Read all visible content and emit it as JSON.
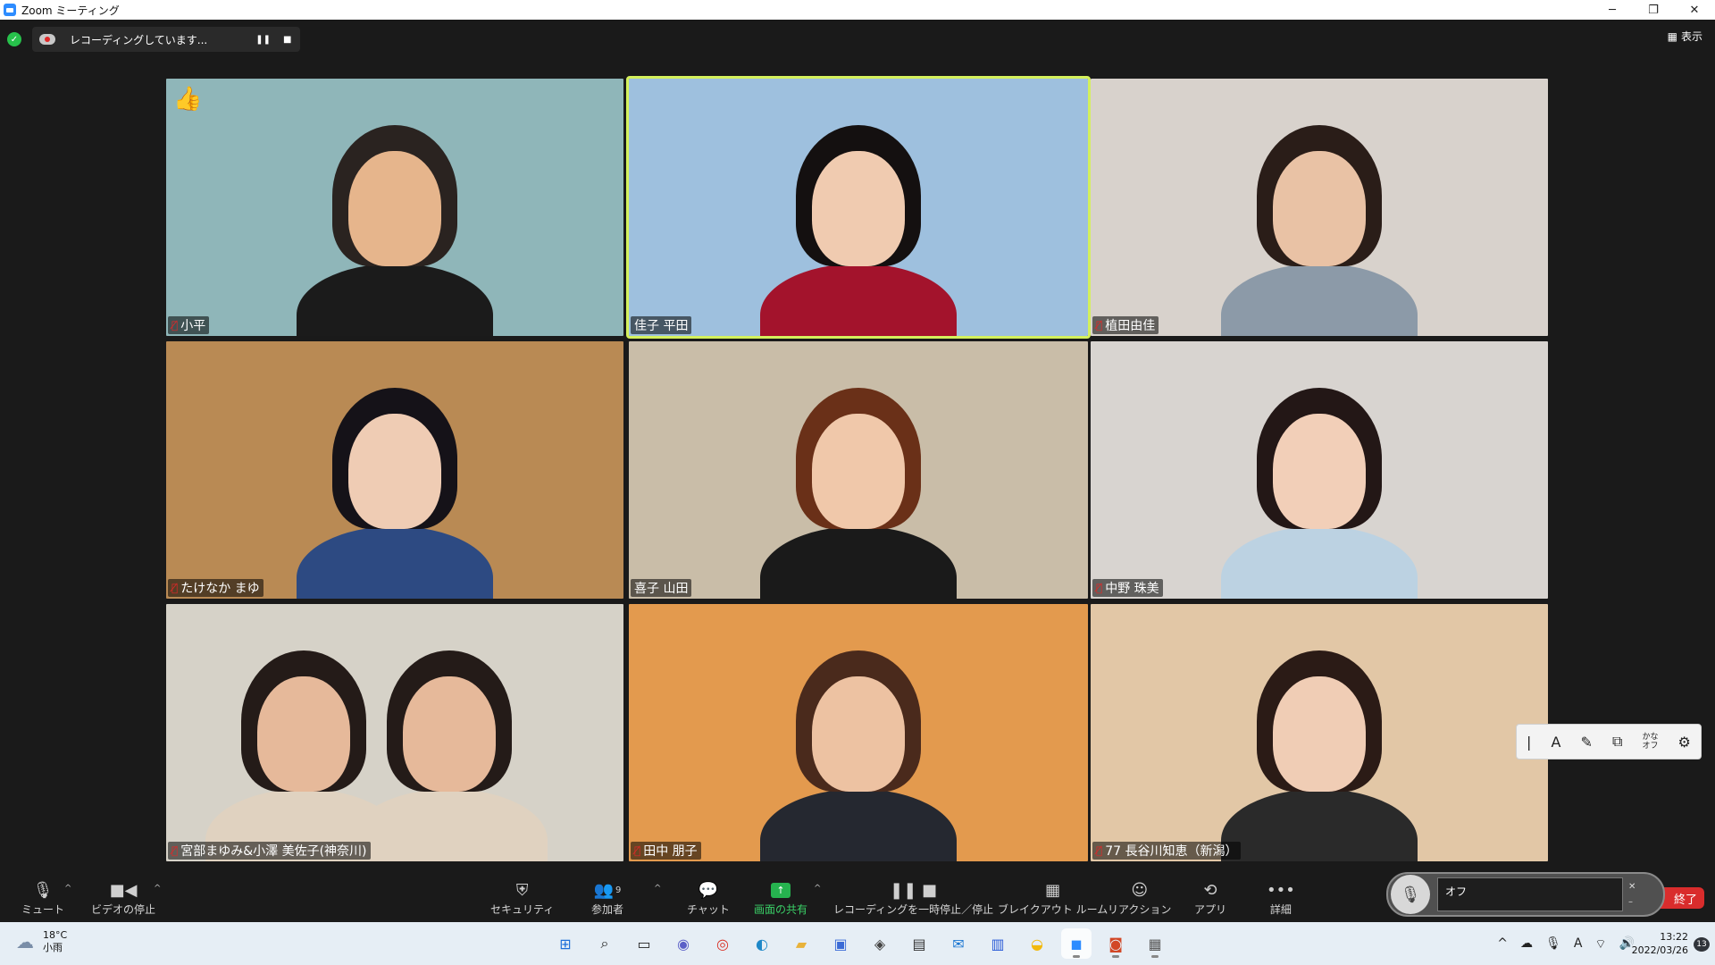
{
  "window": {
    "title": "Zoom ミーティング",
    "controls": [
      "─",
      "❐",
      "✕"
    ]
  },
  "recording": {
    "status": "レコーディングしています...",
    "pause": "❚❚",
    "stop": "■"
  },
  "view": {
    "label": "表示",
    "icon": "grid-icon"
  },
  "participants": [
    {
      "name": "小平",
      "muted": true,
      "bg": "#8fb6b9",
      "skin": "#e6b58c",
      "hair": "#2a2320",
      "shirt": "#1b1b1b",
      "reaction": "👍"
    },
    {
      "name": "佳子 平田",
      "muted": false,
      "bg": "#9ec0de",
      "skin": "#f0cbb0",
      "hair": "#141010",
      "shirt": "#a3132c",
      "active": true
    },
    {
      "name": "植田由佳",
      "muted": true,
      "bg": "#d8d2cc",
      "skin": "#e9c2a5",
      "hair": "#2a1d18",
      "shirt": "#8c9aa8"
    },
    {
      "name": "たけなか まゆ",
      "muted": true,
      "bg": "#b98a54",
      "skin": "#efccb4",
      "hair": "#151218",
      "shirt": "#2d4a82"
    },
    {
      "name": "喜子 山田",
      "muted": false,
      "bg": "#c9bda8",
      "skin": "#f0c8aa",
      "hair": "#6a3018",
      "shirt": "#1a1a1a"
    },
    {
      "name": "中野 珠美",
      "muted": true,
      "bg": "#d8d4d0",
      "skin": "#f2cfb8",
      "hair": "#231716",
      "shirt": "#bcd2e2"
    },
    {
      "name": "宮部まゆみ&小澤 美佐子(神奈川)",
      "muted": true,
      "bg": "#d6d2c8",
      "skin": "#e6b99a",
      "hair": "#241b18",
      "shirt": "#e0d2c0"
    },
    {
      "name": "田中 朋子",
      "muted": true,
      "bg": "#e39a4e",
      "skin": "#edc2a2",
      "hair": "#4a2a1c",
      "shirt": "#252830"
    },
    {
      "name": "77  長谷川知恵（新潟）",
      "muted": true,
      "bg": "#e2c7a6",
      "skin": "#f0cdb5",
      "hair": "#2b1b16",
      "shirt": "#2a2a2a"
    }
  ],
  "palette": {
    "items": [
      "|",
      "A",
      "✎",
      "⧉",
      "かな\nオフ",
      "⚙"
    ],
    "icons": [
      "cursor-icon",
      "font-icon",
      "pen-icon",
      "dictionary-icon",
      "kana-off",
      "settings-icon"
    ]
  },
  "toolbar": {
    "mute": "ミュート",
    "stop_video": "ビデオの停止",
    "security": "セキュリティ",
    "participants": "参加者",
    "participants_count": "9",
    "chat": "チャット",
    "share": "画面の共有",
    "recording": "レコーディングを一時停止／停止",
    "breakout": "ブレイクアウト ルーム",
    "reactions": "リアクション",
    "apps": "アプリ",
    "more": "詳細",
    "end": "終了"
  },
  "ime": {
    "value": "オフ"
  },
  "taskbar": {
    "weather_temp": "18°C",
    "weather_desc": "小雨",
    "time": "13:22",
    "date": "2022/03/26",
    "notifications": "13",
    "ime_indicator": "A",
    "apps": [
      "windows-start-icon",
      "search-icon",
      "task-view-icon",
      "teams-chat-icon",
      "chrome-icon",
      "edge-icon",
      "file-explorer-icon",
      "store-icon",
      "app-icon",
      "app-icon",
      "mail-icon",
      "notepad-icon",
      "sticky-icon",
      "zoom-icon",
      "powerpoint-icon",
      "app-icon"
    ]
  },
  "colors": {
    "active_speaker": "#d4f05c",
    "share_green": "#26b34f",
    "end_red": "#d92c2c"
  }
}
